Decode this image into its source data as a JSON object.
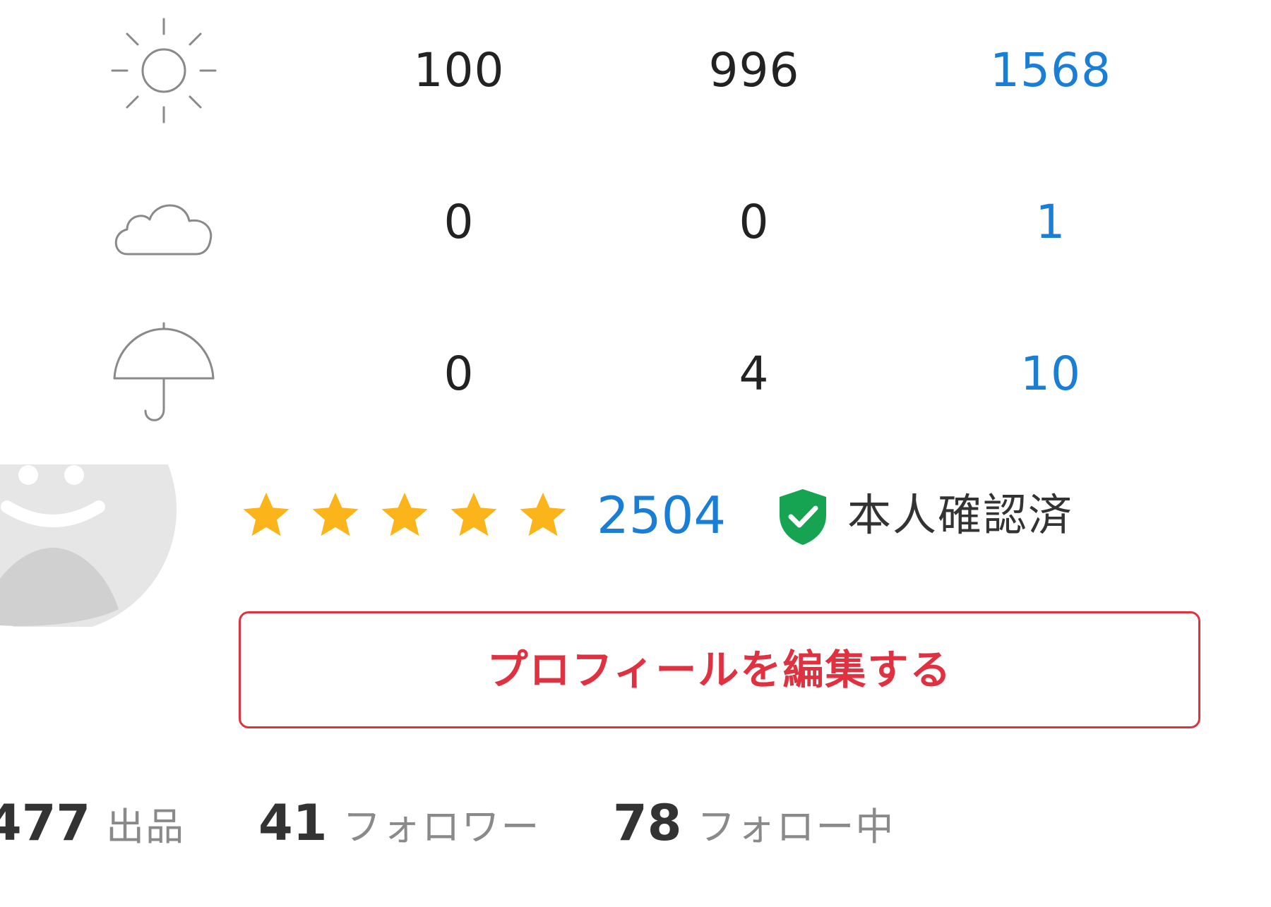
{
  "ratings_table": {
    "rows": [
      {
        "icon": "sun-icon",
        "values": [
          "100",
          "996",
          "1568"
        ]
      },
      {
        "icon": "cloud-icon",
        "values": [
          "0",
          "0",
          "1"
        ]
      },
      {
        "icon": "umbrella-icon",
        "values": [
          "0",
          "4",
          "10"
        ]
      }
    ]
  },
  "profile": {
    "avatar_icon": "smiley-avatar-icon",
    "star_rating": 5,
    "star_max": 5,
    "review_count": "2504",
    "verified_icon": "shield-check-icon",
    "verified_label": "本人確認済",
    "edit_button_label": "プロフィールを編集する"
  },
  "stats": {
    "listings_count": "477",
    "listings_label": "出品",
    "followers_count": "41",
    "followers_label": "フォロワー",
    "following_count": "78",
    "following_label": "フォロー中"
  },
  "colors": {
    "accent_blue": "#1a7ed6",
    "star_yellow": "#fbb41a",
    "verified_green": "#17a452",
    "button_red": "#e03140"
  }
}
